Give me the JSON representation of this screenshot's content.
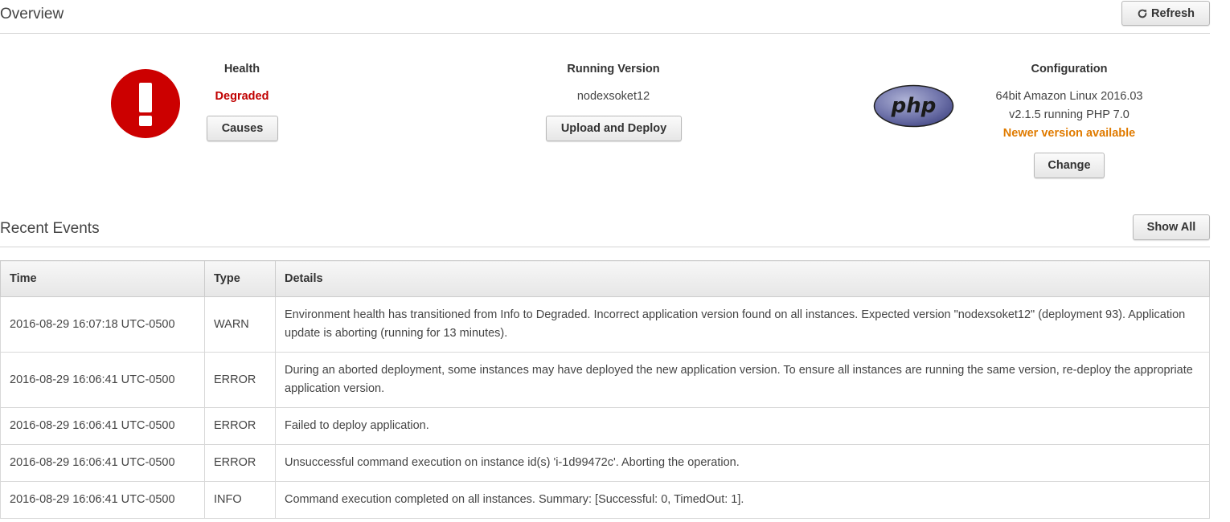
{
  "overview": {
    "title": "Overview",
    "refresh_label": "Refresh"
  },
  "health": {
    "label": "Health",
    "status": "Degraded",
    "causes_label": "Causes",
    "status_color": "#c00000"
  },
  "running_version": {
    "label": "Running Version",
    "version": "nodexsoket12",
    "deploy_label": "Upload and Deploy"
  },
  "configuration": {
    "label": "Configuration",
    "platform_line1": "64bit Amazon Linux 2016.03",
    "platform_line2": "v2.1.5 running PHP 7.0",
    "newer_notice": "Newer version available",
    "change_label": "Change",
    "logo_text": "php"
  },
  "recent_events": {
    "title": "Recent Events",
    "show_all_label": "Show All",
    "columns": [
      "Time",
      "Type",
      "Details"
    ],
    "rows": [
      {
        "time": "2016-08-29 16:07:18 UTC-0500",
        "type": "WARN",
        "details": "Environment health has transitioned from Info to Degraded. Incorrect application version found on all instances. Expected version \"nodexsoket12\" (deployment 93). Application update is aborting (running for 13 minutes)."
      },
      {
        "time": "2016-08-29 16:06:41 UTC-0500",
        "type": "ERROR",
        "details": "During an aborted deployment, some instances may have deployed the new application version. To ensure all instances are running the same version, re-deploy the appropriate application version."
      },
      {
        "time": "2016-08-29 16:06:41 UTC-0500",
        "type": "ERROR",
        "details": "Failed to deploy application."
      },
      {
        "time": "2016-08-29 16:06:41 UTC-0500",
        "type": "ERROR",
        "details": "Unsuccessful command execution on instance id(s) 'i-1d99472c'. Aborting the operation."
      },
      {
        "time": "2016-08-29 16:06:41 UTC-0500",
        "type": "INFO",
        "details": "Command execution completed on all instances. Summary: [Successful: 0, TimedOut: 1]."
      }
    ]
  },
  "icons": {
    "refresh": "refresh-icon",
    "health_status": "exclamation-alert-icon",
    "platform": "php-logo"
  }
}
